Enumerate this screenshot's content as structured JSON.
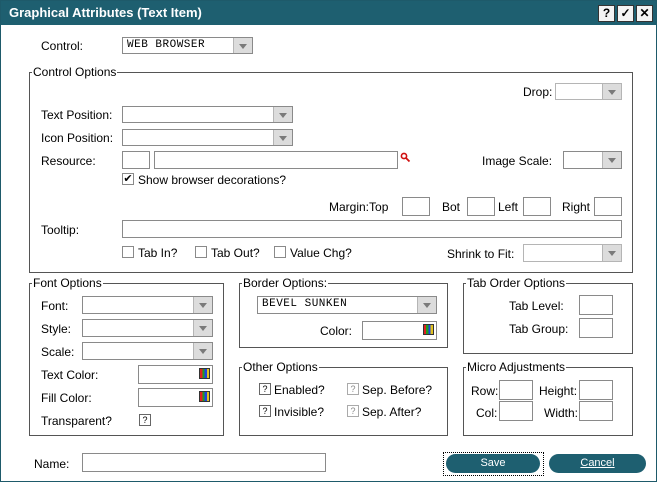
{
  "window": {
    "title": "Graphical Attributes (Text Item)",
    "help": "?",
    "ok": "✓",
    "close": "✕"
  },
  "control": {
    "label": "Control:",
    "value": "WEB BROWSER"
  },
  "control_options": {
    "legend": "Control Options",
    "drop_label": "Drop:",
    "text_position_label": "Text Position:",
    "icon_position_label": "Icon Position:",
    "resource_label": "Resource:",
    "image_scale_label": "Image Scale:",
    "show_decorations_label": "Show browser decorations?",
    "show_decorations_checked": "✔",
    "margin_top_label": "Margin:Top",
    "margin_bot_label": "Bot",
    "margin_left_label": "Left",
    "margin_right_label": "Right",
    "tooltip_label": "Tooltip:",
    "tab_in_label": "Tab In?",
    "tab_out_label": "Tab Out?",
    "value_chg_label": "Value Chg?",
    "shrink_to_fit_label": "Shrink to Fit:"
  },
  "font_options": {
    "legend": "Font Options",
    "font_label": "Font:",
    "style_label": "Style:",
    "scale_label": "Scale:",
    "text_color_label": "Text Color:",
    "fill_color_label": "Fill Color:",
    "transparent_label": "Transparent?",
    "transparent_value": "?"
  },
  "border_options": {
    "legend": "Border Options:",
    "value": "BEVEL SUNKEN",
    "color_label": "Color:"
  },
  "other_options": {
    "legend": "Other Options",
    "enabled_label": "Enabled?",
    "enabled_value": "?",
    "invisible_label": "Invisible?",
    "invisible_value": "?",
    "sep_before_label": "Sep. Before?",
    "sep_before_value": "?",
    "sep_after_label": "Sep. After?",
    "sep_after_value": "?"
  },
  "tab_order": {
    "legend": "Tab Order Options",
    "level_label": "Tab Level:",
    "group_label": "Tab Group:"
  },
  "micro": {
    "legend": "Micro Adjustments",
    "row_label": "Row:",
    "height_label": "Height:",
    "col_label": "Col:",
    "width_label": "Width:"
  },
  "name_label": "Name:",
  "save_label": "Save",
  "cancel_label": "Cancel",
  "colors": {
    "titlebar": "#1e5f70",
    "button": "#1e5f70"
  }
}
